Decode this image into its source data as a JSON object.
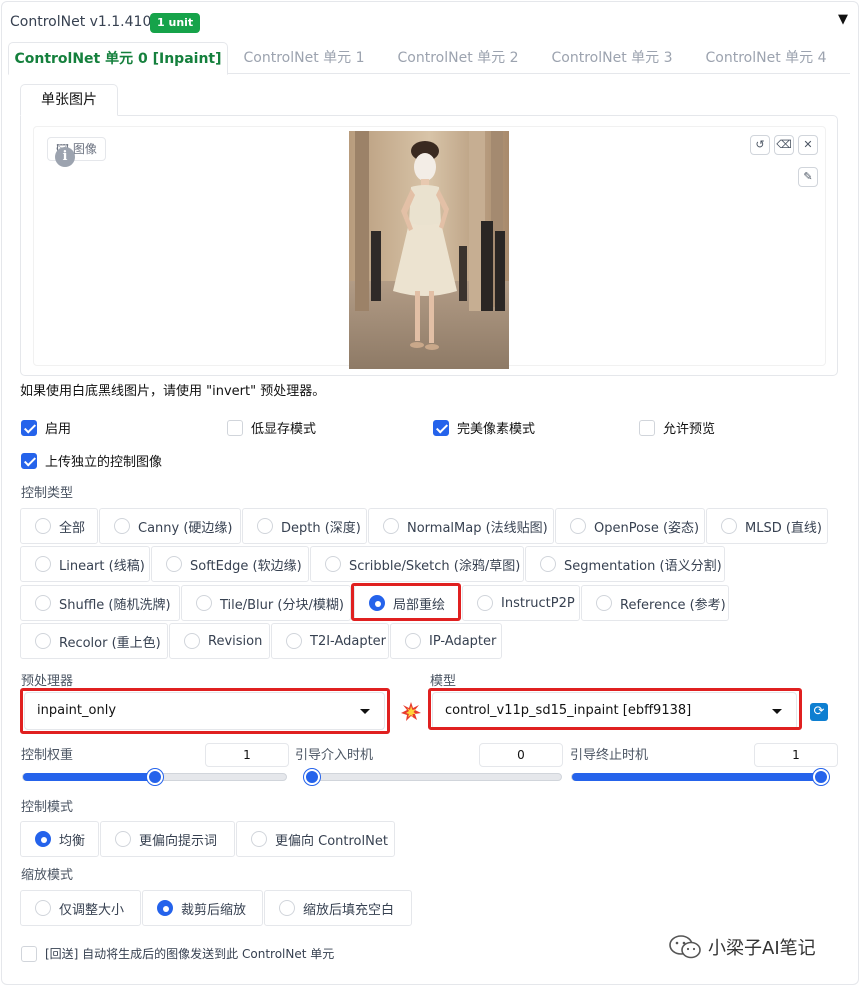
{
  "header": {
    "title": "ControlNet v1.1.410",
    "badge": "1 unit",
    "collapse_glyph": "▼"
  },
  "tabs": [
    {
      "label": "ControlNet 单元 0 [Inpaint]",
      "active": true
    },
    {
      "label": "ControlNet 单元 1",
      "active": false
    },
    {
      "label": "ControlNet 单元 2",
      "active": false
    },
    {
      "label": "ControlNet 单元 3",
      "active": false
    },
    {
      "label": "ControlNet 单元 4",
      "active": false
    }
  ],
  "image_panel": {
    "subtab": "单张图片",
    "image_label": "图像",
    "info_glyph": "i"
  },
  "hint_text": "如果使用白底黑线图片，请使用 \"invert\" 预处理器。",
  "checkboxes": [
    {
      "label": "启用",
      "checked": true
    },
    {
      "label": "低显存模式",
      "checked": false
    },
    {
      "label": "完美像素模式",
      "checked": true
    },
    {
      "label": "允许预览",
      "checked": false
    },
    {
      "label": "上传独立的控制图像",
      "checked": true
    }
  ],
  "control_type": {
    "label": "控制类型",
    "options": [
      "全部",
      "Canny (硬边缘)",
      "Depth (深度)",
      "NormalMap (法线贴图)",
      "OpenPose (姿态)",
      "MLSD (直线)",
      "Lineart (线稿)",
      "SoftEdge (软边缘)",
      "Scribble/Sketch (涂鸦/草图)",
      "Segmentation (语义分割)",
      "Shuffle (随机洗牌)",
      "Tile/Blur (分块/模糊)",
      "局部重绘",
      "InstructP2P",
      "Reference (参考)",
      "Recolor (重上色)",
      "Revision",
      "T2I-Adapter",
      "IP-Adapter"
    ],
    "selected": "局部重绘"
  },
  "preprocessor": {
    "label": "预处理器",
    "value": "inpaint_only"
  },
  "model": {
    "label": "模型",
    "value": "control_v11p_sd15_inpaint [ebff9138]"
  },
  "sliders": [
    {
      "label": "控制权重",
      "value": "1",
      "fraction": 0.5
    },
    {
      "label": "引导介入时机",
      "value": "0",
      "fraction": 0.0
    },
    {
      "label": "引导终止时机",
      "value": "1",
      "fraction": 1.0
    }
  ],
  "control_mode": {
    "label": "控制模式",
    "options": [
      "均衡",
      "更偏向提示词",
      "更偏向 ControlNet"
    ],
    "selected": "均衡"
  },
  "resize_mode": {
    "label": "缩放模式",
    "options": [
      "仅调整大小",
      "裁剪后缩放",
      "缩放后填充空白"
    ],
    "selected": "裁剪后缩放"
  },
  "loopback": {
    "label": "[回送] 自动将生成后的图像发送到此 ControlNet 单元",
    "checked": false
  },
  "watermark": "小梁子AI笔记",
  "colors": {
    "accent": "#2563eb",
    "active_tab": "#15803d",
    "badge": "#16a34a",
    "highlight": "#e02020"
  }
}
